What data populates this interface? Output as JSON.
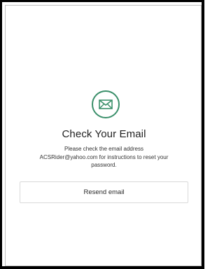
{
  "confirmation": {
    "icon": "envelope-icon",
    "accent_color": "#3a8f6a",
    "title": "Check Your Email",
    "message_line1": "Please check the email address",
    "message_line2": "ACSRider@yahoo.com for instructions to reset your",
    "message_line3": "password.",
    "resend_label": "Resend email"
  }
}
